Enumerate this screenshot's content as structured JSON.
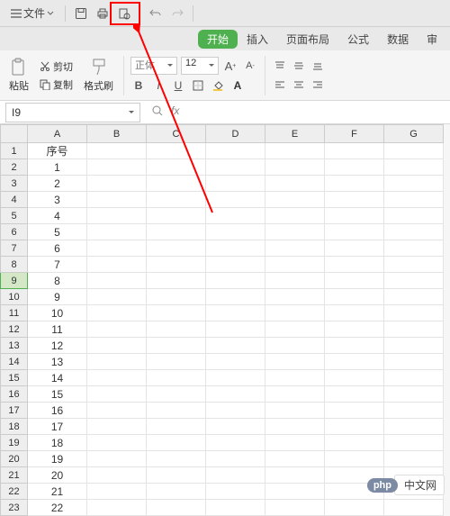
{
  "qat": {
    "file_label": "文件"
  },
  "tabs": {
    "active": "开始",
    "items": [
      "开始",
      "插入",
      "页面布局",
      "公式",
      "数据",
      "审"
    ]
  },
  "ribbon": {
    "paste_label": "粘贴",
    "cut_label": "剪切",
    "copy_label": "复制",
    "format_painter_label": "格式刷",
    "font_name": "正体",
    "font_size": "12"
  },
  "name_box": {
    "value": "I9"
  },
  "fbar": {
    "fx": "fx"
  },
  "grid": {
    "columns": [
      "A",
      "B",
      "C",
      "D",
      "E",
      "F",
      "G"
    ],
    "selected_row": 9,
    "rows": [
      {
        "n": 1,
        "a": "序号"
      },
      {
        "n": 2,
        "a": "1"
      },
      {
        "n": 3,
        "a": "2"
      },
      {
        "n": 4,
        "a": "3"
      },
      {
        "n": 5,
        "a": "4"
      },
      {
        "n": 6,
        "a": "5"
      },
      {
        "n": 7,
        "a": "6"
      },
      {
        "n": 8,
        "a": "7"
      },
      {
        "n": 9,
        "a": "8"
      },
      {
        "n": 10,
        "a": "9"
      },
      {
        "n": 11,
        "a": "10"
      },
      {
        "n": 12,
        "a": "11"
      },
      {
        "n": 13,
        "a": "12"
      },
      {
        "n": 14,
        "a": "13"
      },
      {
        "n": 15,
        "a": "14"
      },
      {
        "n": 16,
        "a": "15"
      },
      {
        "n": 17,
        "a": "16"
      },
      {
        "n": 18,
        "a": "17"
      },
      {
        "n": 19,
        "a": "18"
      },
      {
        "n": 20,
        "a": "19"
      },
      {
        "n": 21,
        "a": "20"
      },
      {
        "n": 22,
        "a": "21"
      },
      {
        "n": 23,
        "a": "22"
      }
    ]
  },
  "watermark": {
    "badge": "php",
    "text": "中文网"
  }
}
